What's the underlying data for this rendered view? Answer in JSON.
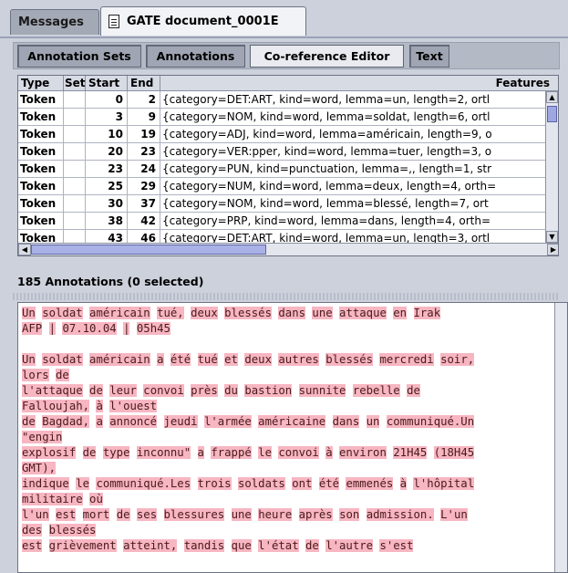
{
  "tabs": [
    {
      "label": "Messages"
    },
    {
      "label": "GATE document_0001E"
    }
  ],
  "toolbar": {
    "annotation_sets": "Annotation Sets",
    "annotations": "Annotations",
    "coref_editor": "Co-reference Editor",
    "text": "Text"
  },
  "table": {
    "headers": [
      "Type",
      "Set",
      "Start",
      "End",
      "Features"
    ],
    "rows": [
      {
        "type": "Token",
        "set": "",
        "start": "0",
        "end": "2",
        "features": "{category=DET:ART, kind=word, lemma=un, length=2, ortl"
      },
      {
        "type": "Token",
        "set": "",
        "start": "3",
        "end": "9",
        "features": "{category=NOM, kind=word, lemma=soldat, length=6, ortl"
      },
      {
        "type": "Token",
        "set": "",
        "start": "10",
        "end": "19",
        "features": "{category=ADJ, kind=word, lemma=américain, length=9, o"
      },
      {
        "type": "Token",
        "set": "",
        "start": "20",
        "end": "23",
        "features": "{category=VER:pper, kind=word, lemma=tuer, length=3, o"
      },
      {
        "type": "Token",
        "set": "",
        "start": "23",
        "end": "24",
        "features": "{category=PUN, kind=punctuation, lemma=,, length=1, str"
      },
      {
        "type": "Token",
        "set": "",
        "start": "25",
        "end": "29",
        "features": "{category=NUM, kind=word, lemma=deux, length=4, orth="
      },
      {
        "type": "Token",
        "set": "",
        "start": "30",
        "end": "37",
        "features": "{category=NOM, kind=word, lemma=blessé, length=7, ort"
      },
      {
        "type": "Token",
        "set": "",
        "start": "38",
        "end": "42",
        "features": "{category=PRP, kind=word, lemma=dans, length=4, orth="
      },
      {
        "type": "Token",
        "set": "",
        "start": "43",
        "end": "46",
        "features": "{category=DET:ART, kind=word, lemma=un, length=3, ortl"
      }
    ]
  },
  "status": "185 Annotations (0 selected)",
  "document_lines": [
    "Un soldat américain tué, deux blessés dans une attaque en Irak",
    "AFP | 07.10.04 | 05h45",
    "",
    "Un soldat américain a été tué et deux autres blessés mercredi soir,",
    "lors de",
    "l'attaque de leur convoi près du bastion sunnite rebelle de",
    "Falloujah, à l'ouest",
    "de Bagdad, a annoncé jeudi l'armée américaine dans un communiqué.Un",
    "\"engin",
    "explosif de type inconnu\" a frappé le convoi à environ 21H45 (18H45",
    "GMT),",
    "indique le communiqué.Les trois soldats ont été emmenés à l'hôpital",
    "militaire où",
    "l'un est mort de ses blessures une heure après son admission. L'un",
    "des blessés",
    "est grièvement atteint, tandis que l'état de l'autre s'est"
  ],
  "colors": {
    "highlight": "#f7b6c2",
    "scroll_thumb": "#9ea7e0"
  }
}
